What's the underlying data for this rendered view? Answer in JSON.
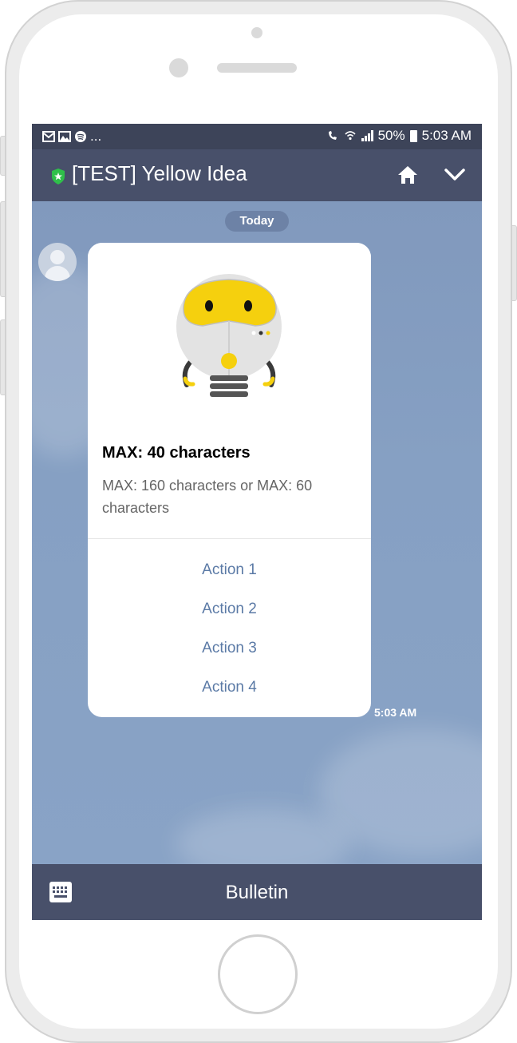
{
  "status_bar": {
    "left_icons": [
      "gmail-icon",
      "image-icon",
      "spotify-icon"
    ],
    "ellipsis": "...",
    "battery": "50%",
    "time": "5:03 AM"
  },
  "header": {
    "title": "[TEST] Yellow Idea",
    "icons": [
      "shield-star-icon",
      "home-icon",
      "chevron-down-icon"
    ]
  },
  "chat": {
    "date_label": "Today",
    "message": {
      "title": "MAX: 40 characters",
      "text": "MAX: 160 characters or MAX: 60 characters",
      "actions": [
        "Action 1",
        "Action 2",
        "Action 3",
        "Action 4"
      ],
      "time": "5:03 AM"
    }
  },
  "bottom_bar": {
    "label": "Bulletin",
    "icon": "keyboard-icon"
  },
  "colors": {
    "header_bg": "#48506a",
    "status_bg": "#3d4459",
    "chat_bg": "#8aa3c4",
    "action_text": "#5b7aa6",
    "brand_yellow": "#f5d00e",
    "shield_green": "#2fbf4a"
  }
}
